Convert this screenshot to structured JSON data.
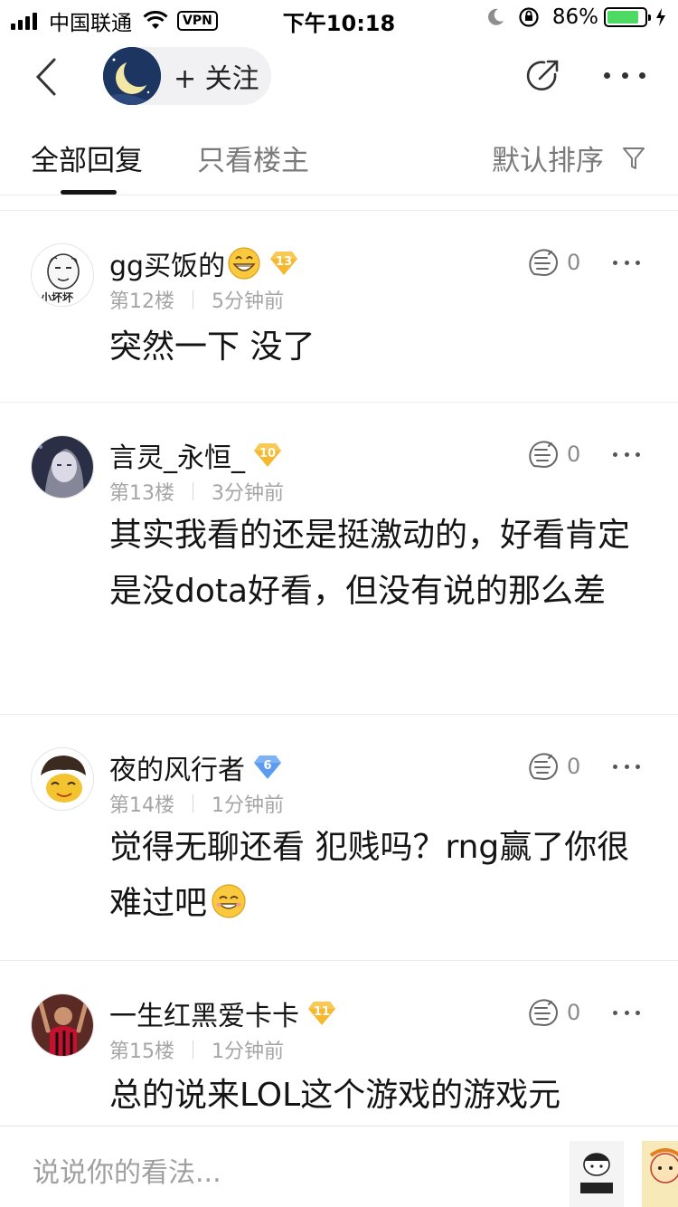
{
  "status_bar": {
    "carrier": "中国联通",
    "vpn": "VPN",
    "time": "下午10:18",
    "battery": "86%"
  },
  "nav": {
    "follow_label": "+ 关注"
  },
  "tabs": {
    "all": "全部回复",
    "owner_only": "只看楼主",
    "sort": "默认排序"
  },
  "comments": [
    {
      "name": "gg买饭的",
      "level": "13",
      "floor": "第12楼",
      "time": "5分钟前",
      "likes": "0",
      "text": "突然一下 没了",
      "avatar_text": "小坏坏"
    },
    {
      "name": "言灵_永恒_",
      "level": "10",
      "floor": "第13楼",
      "time": "3分钟前",
      "likes": "0",
      "text": "其实我看的还是挺激动的，好看肯定是没dota好看，但没有说的那么差"
    },
    {
      "name": "夜的风行者",
      "level": "6",
      "floor": "第14楼",
      "time": "1分钟前",
      "likes": "0",
      "text": "觉得无聊还看 犯贱吗？rng赢了你很难过吧"
    },
    {
      "name": "一生红黑爱卡卡",
      "level": "11",
      "floor": "第15楼",
      "time": "1分钟前",
      "likes": "0",
      "text": "总的说来LOL这个游戏的游戏元"
    }
  ],
  "bottom_bar": {
    "input_placeholder": "说说你的看法..."
  },
  "colors": {
    "badge_gold": "#f5b82e",
    "badge_blue": "#5b9bf0",
    "battery_green": "#4cd964",
    "muted_text": "#a5a5a5"
  },
  "icons": [
    "signal-icon",
    "wifi-icon",
    "moon-icon",
    "lock-rotation-icon",
    "battery-icon",
    "charging-icon",
    "back-chevron-icon",
    "share-icon",
    "more-icon",
    "filter-icon",
    "like-icon",
    "level-badge-icon"
  ]
}
